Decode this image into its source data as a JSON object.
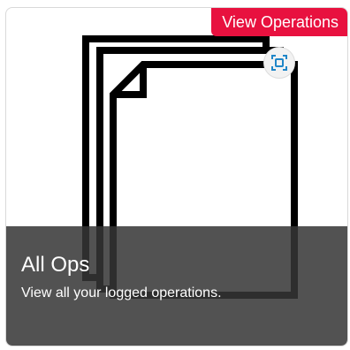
{
  "card": {
    "title": "All Ops",
    "description": "View all your logged operations.",
    "action_label": "View Operations"
  },
  "icons": {
    "illustration": "stacked-documents-icon",
    "action": "scan-icon"
  },
  "colors": {
    "badge_background": "#e8113f",
    "overlay_background": "#353535",
    "scan_icon": "#1f86c8",
    "illustration_stroke": "#000000"
  }
}
